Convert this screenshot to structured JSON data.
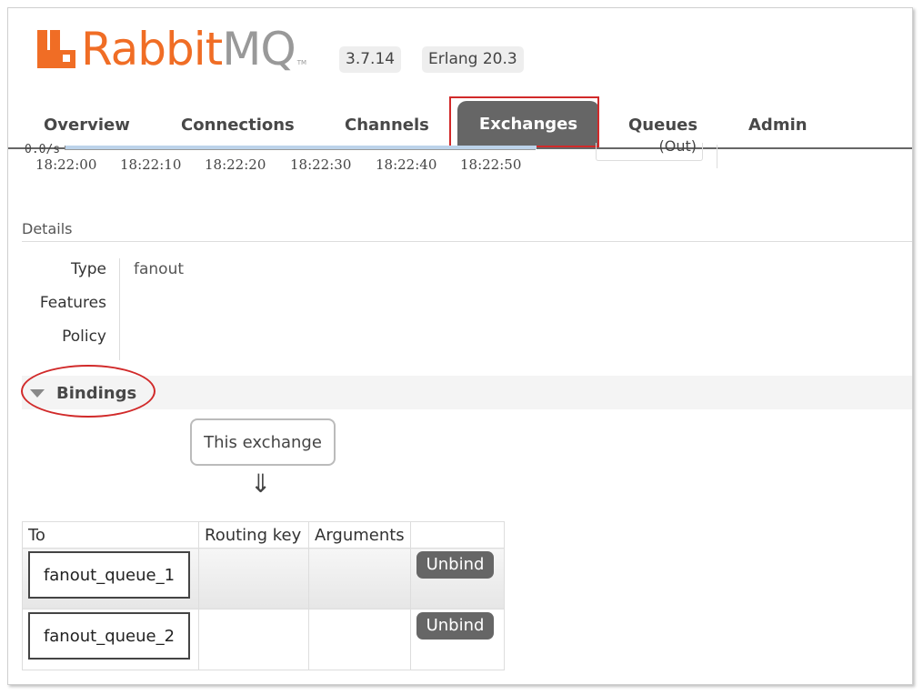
{
  "header": {
    "logo_rabbit": "Rabbit",
    "logo_mq": "MQ",
    "logo_tm": "TM",
    "version": "3.7.14",
    "erlang": "Erlang 20.3"
  },
  "tabs": [
    {
      "label": "Overview"
    },
    {
      "label": "Connections"
    },
    {
      "label": "Channels"
    },
    {
      "label": "Exchanges",
      "active": true
    },
    {
      "label": "Queues"
    },
    {
      "label": "Admin"
    }
  ],
  "chart": {
    "zero_label": "0.0/s",
    "ticks": [
      "18:22:00",
      "18:22:10",
      "18:22:20",
      "18:22:30",
      "18:22:40",
      "18:22:50"
    ],
    "legend_out": "(Out)"
  },
  "details": {
    "title": "Details",
    "rows": [
      {
        "label": "Type",
        "value": "fanout"
      },
      {
        "label": "Features",
        "value": ""
      },
      {
        "label": "Policy",
        "value": ""
      }
    ]
  },
  "bindings": {
    "title": "Bindings",
    "source_label": "This exchange",
    "arrow": "⇓",
    "columns": [
      "To",
      "Routing key",
      "Arguments",
      ""
    ],
    "rows": [
      {
        "to": "fanout_queue_1",
        "routing_key": "",
        "arguments": "",
        "action": "Unbind"
      },
      {
        "to": "fanout_queue_2",
        "routing_key": "",
        "arguments": "",
        "action": "Unbind"
      }
    ]
  },
  "colors": {
    "brand_orange": "#f06d25",
    "tab_active": "#666666",
    "annotation_red": "#d12a2a"
  }
}
